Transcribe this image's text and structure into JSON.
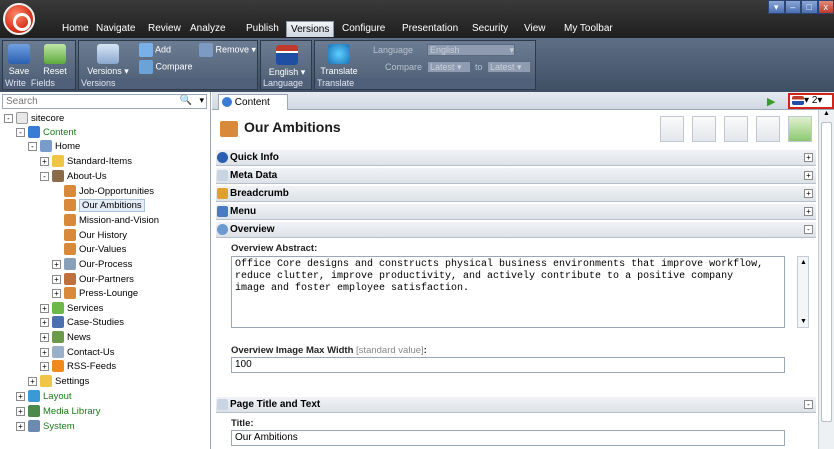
{
  "menu": {
    "tabs": [
      "Home",
      "Navigate",
      "Review",
      "Analyze",
      "Publish",
      "Versions",
      "Configure",
      "Presentation",
      "Security",
      "View",
      "My Toolbar"
    ],
    "active": "Versions"
  },
  "ribbon": {
    "write": {
      "save": "Save",
      "reset": "Reset",
      "fields": "Fields",
      "group_write": "Write",
      "group_fields": "Fields"
    },
    "versions": {
      "versions_btn": "Versions",
      "add": "Add",
      "compare": "Compare",
      "remove": "Remove",
      "group": "Versions"
    },
    "language": {
      "btn": "English",
      "group": "Language"
    },
    "translate": {
      "btn": "Translate",
      "language_label": "Language",
      "language_value": "English",
      "compare_label": "Compare",
      "from": "Latest",
      "to_label": "to",
      "to": "Latest",
      "group": "Translate"
    }
  },
  "search": {
    "placeholder": "Search"
  },
  "tree": [
    {
      "label": "sitecore"
    },
    {
      "label": "Content"
    },
    {
      "label": "Home"
    },
    {
      "label": "Standard-Items"
    },
    {
      "label": "About-Us"
    },
    {
      "label": "Job-Opportunities"
    },
    {
      "label": "Our Ambitions"
    },
    {
      "label": "Mission-and-Vision"
    },
    {
      "label": "Our History"
    },
    {
      "label": "Our-Values"
    },
    {
      "label": "Our-Process"
    },
    {
      "label": "Our-Partners"
    },
    {
      "label": "Press-Lounge"
    },
    {
      "label": "Services"
    },
    {
      "label": "Case-Studies"
    },
    {
      "label": "News"
    },
    {
      "label": "Contact-Us"
    },
    {
      "label": "RSS-Feeds"
    },
    {
      "label": "Settings"
    },
    {
      "label": "Layout"
    },
    {
      "label": "Media Library"
    },
    {
      "label": "System"
    }
  ],
  "content": {
    "tab": "Content",
    "version": "2",
    "item_title": "Our Ambitions",
    "sections": [
      "Quick Info",
      "Meta Data",
      "Breadcrumb",
      "Menu",
      "Overview",
      "Page Title and Text"
    ],
    "overview_abstract_label": "Overview Abstract:",
    "overview_abstract": "Office Core designs and constructs physical business environments that improve workflow, reduce clutter, improve productivity, and actively contribute to a positive company image and foster employee satisfaction.",
    "image_width_label": "Overview Image Max Width",
    "image_width_sv": "[standard value]",
    "image_width_colon": ":",
    "image_width_value": "100",
    "title_label": "Title:",
    "title_value": "Our Ambitions"
  },
  "icons": {
    "logo": "sitecore-logo-icon",
    "lang_flag": "flag-icon"
  }
}
